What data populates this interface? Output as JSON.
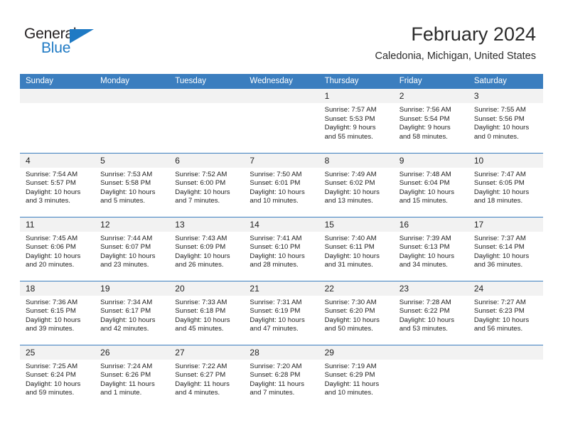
{
  "brand": {
    "name_top": "General",
    "name_bottom": "Blue",
    "accent_color": "#1f7ac4",
    "triangle_icon": "triangle-icon"
  },
  "header": {
    "title": "February 2024",
    "subtitle": "Caledonia, Michigan, United States"
  },
  "theme": {
    "header_bg": "#3b7ebf",
    "daynum_bg": "#f2f2f2",
    "text": "#222222"
  },
  "weekdays": [
    "Sunday",
    "Monday",
    "Tuesday",
    "Wednesday",
    "Thursday",
    "Friday",
    "Saturday"
  ],
  "weeks": [
    [
      {
        "day": "",
        "lines": []
      },
      {
        "day": "",
        "lines": []
      },
      {
        "day": "",
        "lines": []
      },
      {
        "day": "",
        "lines": []
      },
      {
        "day": "1",
        "lines": [
          "Sunrise: 7:57 AM",
          "Sunset: 5:53 PM",
          "Daylight: 9 hours",
          "and 55 minutes."
        ]
      },
      {
        "day": "2",
        "lines": [
          "Sunrise: 7:56 AM",
          "Sunset: 5:54 PM",
          "Daylight: 9 hours",
          "and 58 minutes."
        ]
      },
      {
        "day": "3",
        "lines": [
          "Sunrise: 7:55 AM",
          "Sunset: 5:56 PM",
          "Daylight: 10 hours",
          "and 0 minutes."
        ]
      }
    ],
    [
      {
        "day": "4",
        "lines": [
          "Sunrise: 7:54 AM",
          "Sunset: 5:57 PM",
          "Daylight: 10 hours",
          "and 3 minutes."
        ]
      },
      {
        "day": "5",
        "lines": [
          "Sunrise: 7:53 AM",
          "Sunset: 5:58 PM",
          "Daylight: 10 hours",
          "and 5 minutes."
        ]
      },
      {
        "day": "6",
        "lines": [
          "Sunrise: 7:52 AM",
          "Sunset: 6:00 PM",
          "Daylight: 10 hours",
          "and 7 minutes."
        ]
      },
      {
        "day": "7",
        "lines": [
          "Sunrise: 7:50 AM",
          "Sunset: 6:01 PM",
          "Daylight: 10 hours",
          "and 10 minutes."
        ]
      },
      {
        "day": "8",
        "lines": [
          "Sunrise: 7:49 AM",
          "Sunset: 6:02 PM",
          "Daylight: 10 hours",
          "and 13 minutes."
        ]
      },
      {
        "day": "9",
        "lines": [
          "Sunrise: 7:48 AM",
          "Sunset: 6:04 PM",
          "Daylight: 10 hours",
          "and 15 minutes."
        ]
      },
      {
        "day": "10",
        "lines": [
          "Sunrise: 7:47 AM",
          "Sunset: 6:05 PM",
          "Daylight: 10 hours",
          "and 18 minutes."
        ]
      }
    ],
    [
      {
        "day": "11",
        "lines": [
          "Sunrise: 7:45 AM",
          "Sunset: 6:06 PM",
          "Daylight: 10 hours",
          "and 20 minutes."
        ]
      },
      {
        "day": "12",
        "lines": [
          "Sunrise: 7:44 AM",
          "Sunset: 6:07 PM",
          "Daylight: 10 hours",
          "and 23 minutes."
        ]
      },
      {
        "day": "13",
        "lines": [
          "Sunrise: 7:43 AM",
          "Sunset: 6:09 PM",
          "Daylight: 10 hours",
          "and 26 minutes."
        ]
      },
      {
        "day": "14",
        "lines": [
          "Sunrise: 7:41 AM",
          "Sunset: 6:10 PM",
          "Daylight: 10 hours",
          "and 28 minutes."
        ]
      },
      {
        "day": "15",
        "lines": [
          "Sunrise: 7:40 AM",
          "Sunset: 6:11 PM",
          "Daylight: 10 hours",
          "and 31 minutes."
        ]
      },
      {
        "day": "16",
        "lines": [
          "Sunrise: 7:39 AM",
          "Sunset: 6:13 PM",
          "Daylight: 10 hours",
          "and 34 minutes."
        ]
      },
      {
        "day": "17",
        "lines": [
          "Sunrise: 7:37 AM",
          "Sunset: 6:14 PM",
          "Daylight: 10 hours",
          "and 36 minutes."
        ]
      }
    ],
    [
      {
        "day": "18",
        "lines": [
          "Sunrise: 7:36 AM",
          "Sunset: 6:15 PM",
          "Daylight: 10 hours",
          "and 39 minutes."
        ]
      },
      {
        "day": "19",
        "lines": [
          "Sunrise: 7:34 AM",
          "Sunset: 6:17 PM",
          "Daylight: 10 hours",
          "and 42 minutes."
        ]
      },
      {
        "day": "20",
        "lines": [
          "Sunrise: 7:33 AM",
          "Sunset: 6:18 PM",
          "Daylight: 10 hours",
          "and 45 minutes."
        ]
      },
      {
        "day": "21",
        "lines": [
          "Sunrise: 7:31 AM",
          "Sunset: 6:19 PM",
          "Daylight: 10 hours",
          "and 47 minutes."
        ]
      },
      {
        "day": "22",
        "lines": [
          "Sunrise: 7:30 AM",
          "Sunset: 6:20 PM",
          "Daylight: 10 hours",
          "and 50 minutes."
        ]
      },
      {
        "day": "23",
        "lines": [
          "Sunrise: 7:28 AM",
          "Sunset: 6:22 PM",
          "Daylight: 10 hours",
          "and 53 minutes."
        ]
      },
      {
        "day": "24",
        "lines": [
          "Sunrise: 7:27 AM",
          "Sunset: 6:23 PM",
          "Daylight: 10 hours",
          "and 56 minutes."
        ]
      }
    ],
    [
      {
        "day": "25",
        "lines": [
          "Sunrise: 7:25 AM",
          "Sunset: 6:24 PM",
          "Daylight: 10 hours",
          "and 59 minutes."
        ]
      },
      {
        "day": "26",
        "lines": [
          "Sunrise: 7:24 AM",
          "Sunset: 6:26 PM",
          "Daylight: 11 hours",
          "and 1 minute."
        ]
      },
      {
        "day": "27",
        "lines": [
          "Sunrise: 7:22 AM",
          "Sunset: 6:27 PM",
          "Daylight: 11 hours",
          "and 4 minutes."
        ]
      },
      {
        "day": "28",
        "lines": [
          "Sunrise: 7:20 AM",
          "Sunset: 6:28 PM",
          "Daylight: 11 hours",
          "and 7 minutes."
        ]
      },
      {
        "day": "29",
        "lines": [
          "Sunrise: 7:19 AM",
          "Sunset: 6:29 PM",
          "Daylight: 11 hours",
          "and 10 minutes."
        ]
      },
      {
        "day": "",
        "lines": []
      },
      {
        "day": "",
        "lines": []
      }
    ]
  ]
}
